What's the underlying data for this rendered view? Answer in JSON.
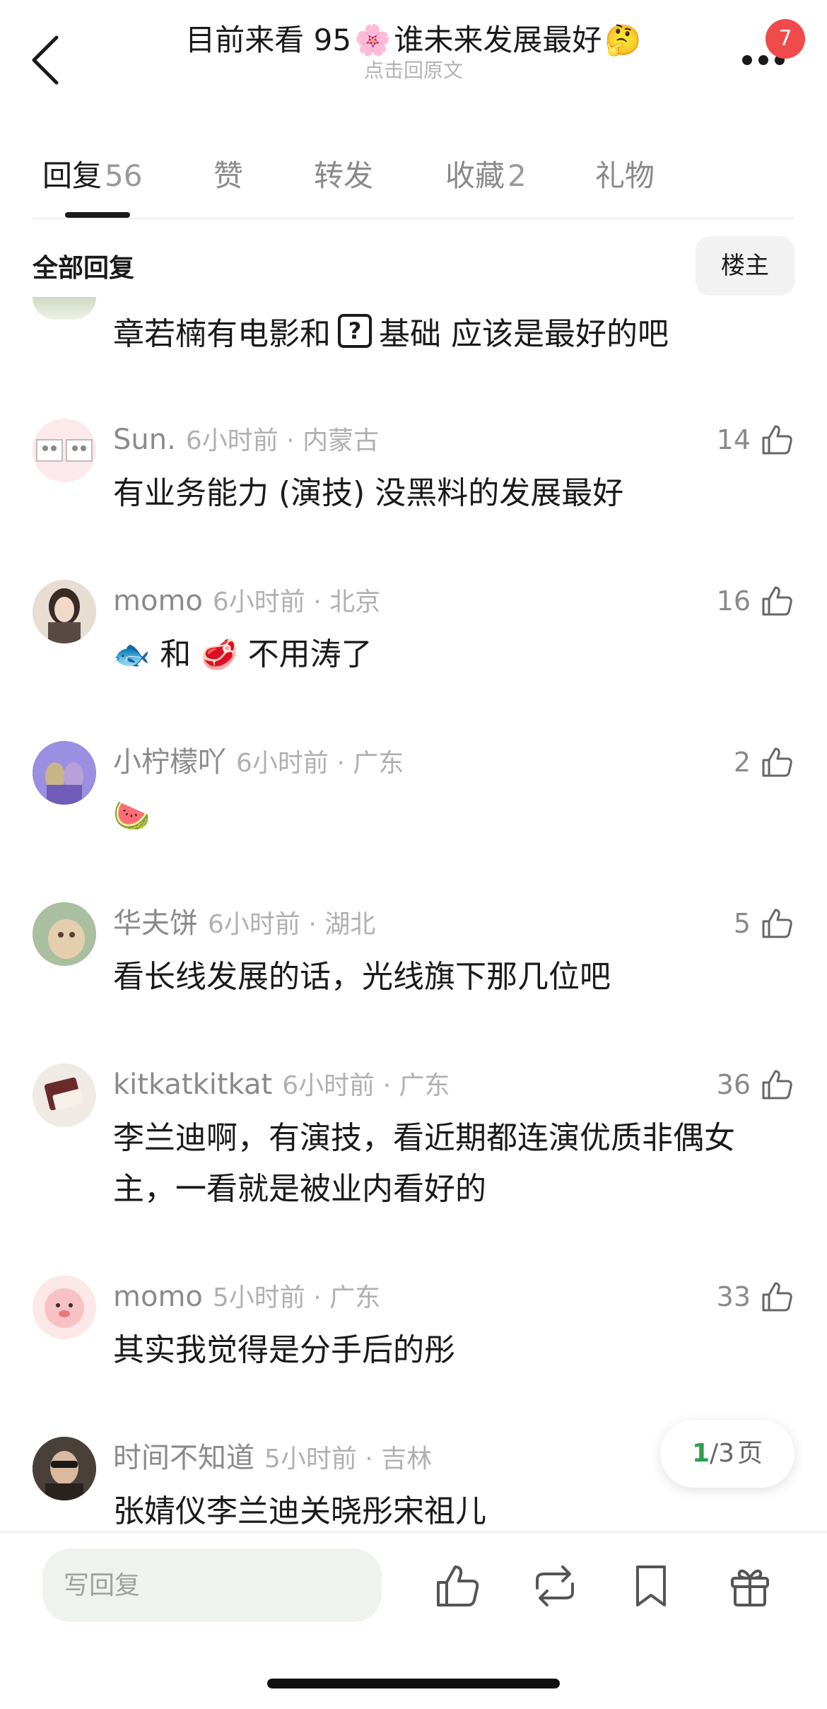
{
  "header": {
    "title_text": "目前来看 95",
    "title_emoji_flower": "🌸",
    "title_text_2": "谁未来发展最好",
    "title_emoji_think": "🤔",
    "subtitle": "点击回原文",
    "badge_count": "7"
  },
  "tabs": [
    {
      "label": "回复",
      "count": "56"
    },
    {
      "label": "赞",
      "count": ""
    },
    {
      "label": "转发",
      "count": ""
    },
    {
      "label": "收藏",
      "count": "2"
    },
    {
      "label": "礼物",
      "count": ""
    }
  ],
  "filter": {
    "label": "全部回复",
    "op_button": "楼主"
  },
  "partial_comment": {
    "text_before": "章若楠有电影和",
    "box_symbol": "?",
    "text_after": "基础 应该是最好的吧"
  },
  "comments": [
    {
      "name": "Sun.",
      "time": "6小时前",
      "location": "内蒙古",
      "likes": "14",
      "text": "有业务能力 (演技) 没黑料的发展最好"
    },
    {
      "name": "momo",
      "time": "6小时前",
      "location": "北京",
      "likes": "16",
      "emoji_1": "🐟",
      "text_mid": "和",
      "emoji_2": "🥩",
      "text_end": "不用涛了"
    },
    {
      "name": "小柠檬吖",
      "time": "6小时前",
      "location": "广东",
      "likes": "2",
      "emoji_1": "🍉"
    },
    {
      "name": "华夫饼",
      "time": "6小时前",
      "location": "湖北",
      "likes": "5",
      "text": "看长线发展的话，光线旗下那几位吧"
    },
    {
      "name": "kitkatkitkat",
      "time": "6小时前",
      "location": "广东",
      "likes": "36",
      "text": "李兰迪啊，有演技，看近期都连演优质非偶女主，一看就是被业内看好的"
    },
    {
      "name": "momo",
      "time": "5小时前",
      "location": "广东",
      "likes": "33",
      "text": "其实我觉得是分手后的彤"
    },
    {
      "name": "时间不知道",
      "time": "5小时前",
      "location": "吉林",
      "likes": "",
      "text": "张婧仪李兰迪关晓彤宋祖儿"
    }
  ],
  "meta_separator": "·",
  "pager": {
    "current": "1",
    "total": "/3",
    "unit": "页"
  },
  "bottom_bar": {
    "reply_placeholder": "写回复"
  },
  "colors": {
    "accent_green": "#2e9e4e",
    "badge_red": "#f04a4a"
  }
}
